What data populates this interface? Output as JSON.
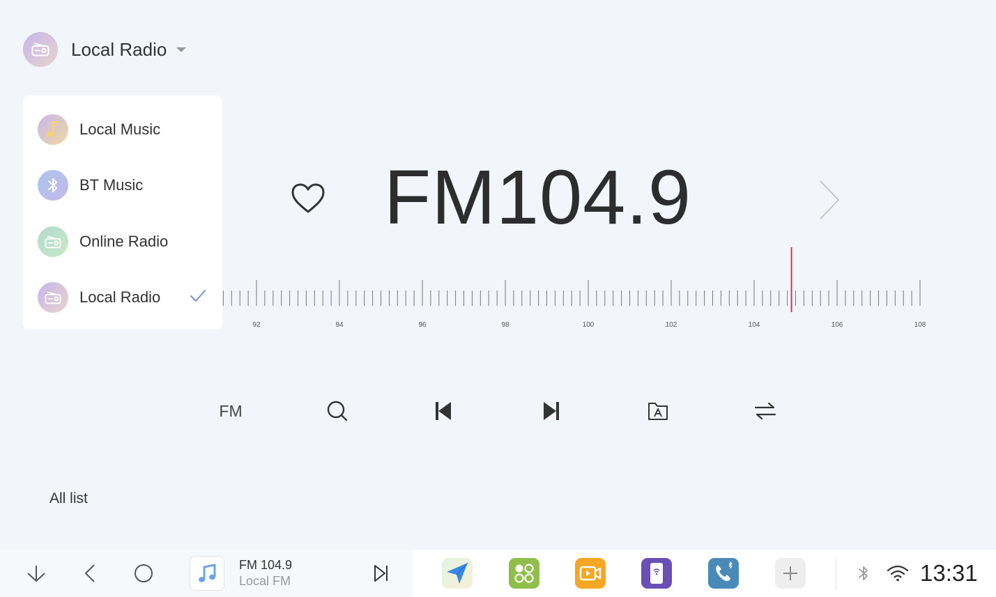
{
  "header": {
    "title": "Local Radio",
    "icon": "radio-icon"
  },
  "dropdown": {
    "items": [
      {
        "label": "Local Music",
        "icon": "music-note-icon",
        "selected": false
      },
      {
        "label": "BT Music",
        "icon": "bluetooth-icon",
        "selected": false
      },
      {
        "label": "Online Radio",
        "icon": "radio-icon",
        "selected": false
      },
      {
        "label": "Local Radio",
        "icon": "radio-icon",
        "selected": true
      }
    ]
  },
  "player": {
    "frequency": "FM104.9",
    "favorite_icon": "heart-outline-icon",
    "next_icon": "chevron-right-icon"
  },
  "tuner": {
    "labels": [
      "92",
      "94",
      "96",
      "98",
      "100",
      "102",
      "104",
      "106",
      "108"
    ],
    "current_frequency": 104.9,
    "indicator_color": "#d0393e"
  },
  "controls": {
    "band_label": "FM",
    "buttons": [
      "band-button",
      "search-button",
      "previous-station-button",
      "next-station-button",
      "station-list-button",
      "switch-button"
    ]
  },
  "all_list": {
    "label": "All list"
  },
  "taskbar": {
    "now_playing": {
      "title": "FM 104.9",
      "subtitle": "Local FM"
    },
    "apps": [
      {
        "name": "navigation-app",
        "color": "#4a8fe8"
      },
      {
        "name": "apps-launcher",
        "color": "#8fbf4a"
      },
      {
        "name": "video-app",
        "color": "#f5a623"
      },
      {
        "name": "phone-link-app",
        "color": "#6a4fb6"
      },
      {
        "name": "phone-app",
        "color": "#4a8ab8"
      },
      {
        "name": "add-app",
        "color": "#eeeeee"
      }
    ],
    "time": "13:31"
  }
}
